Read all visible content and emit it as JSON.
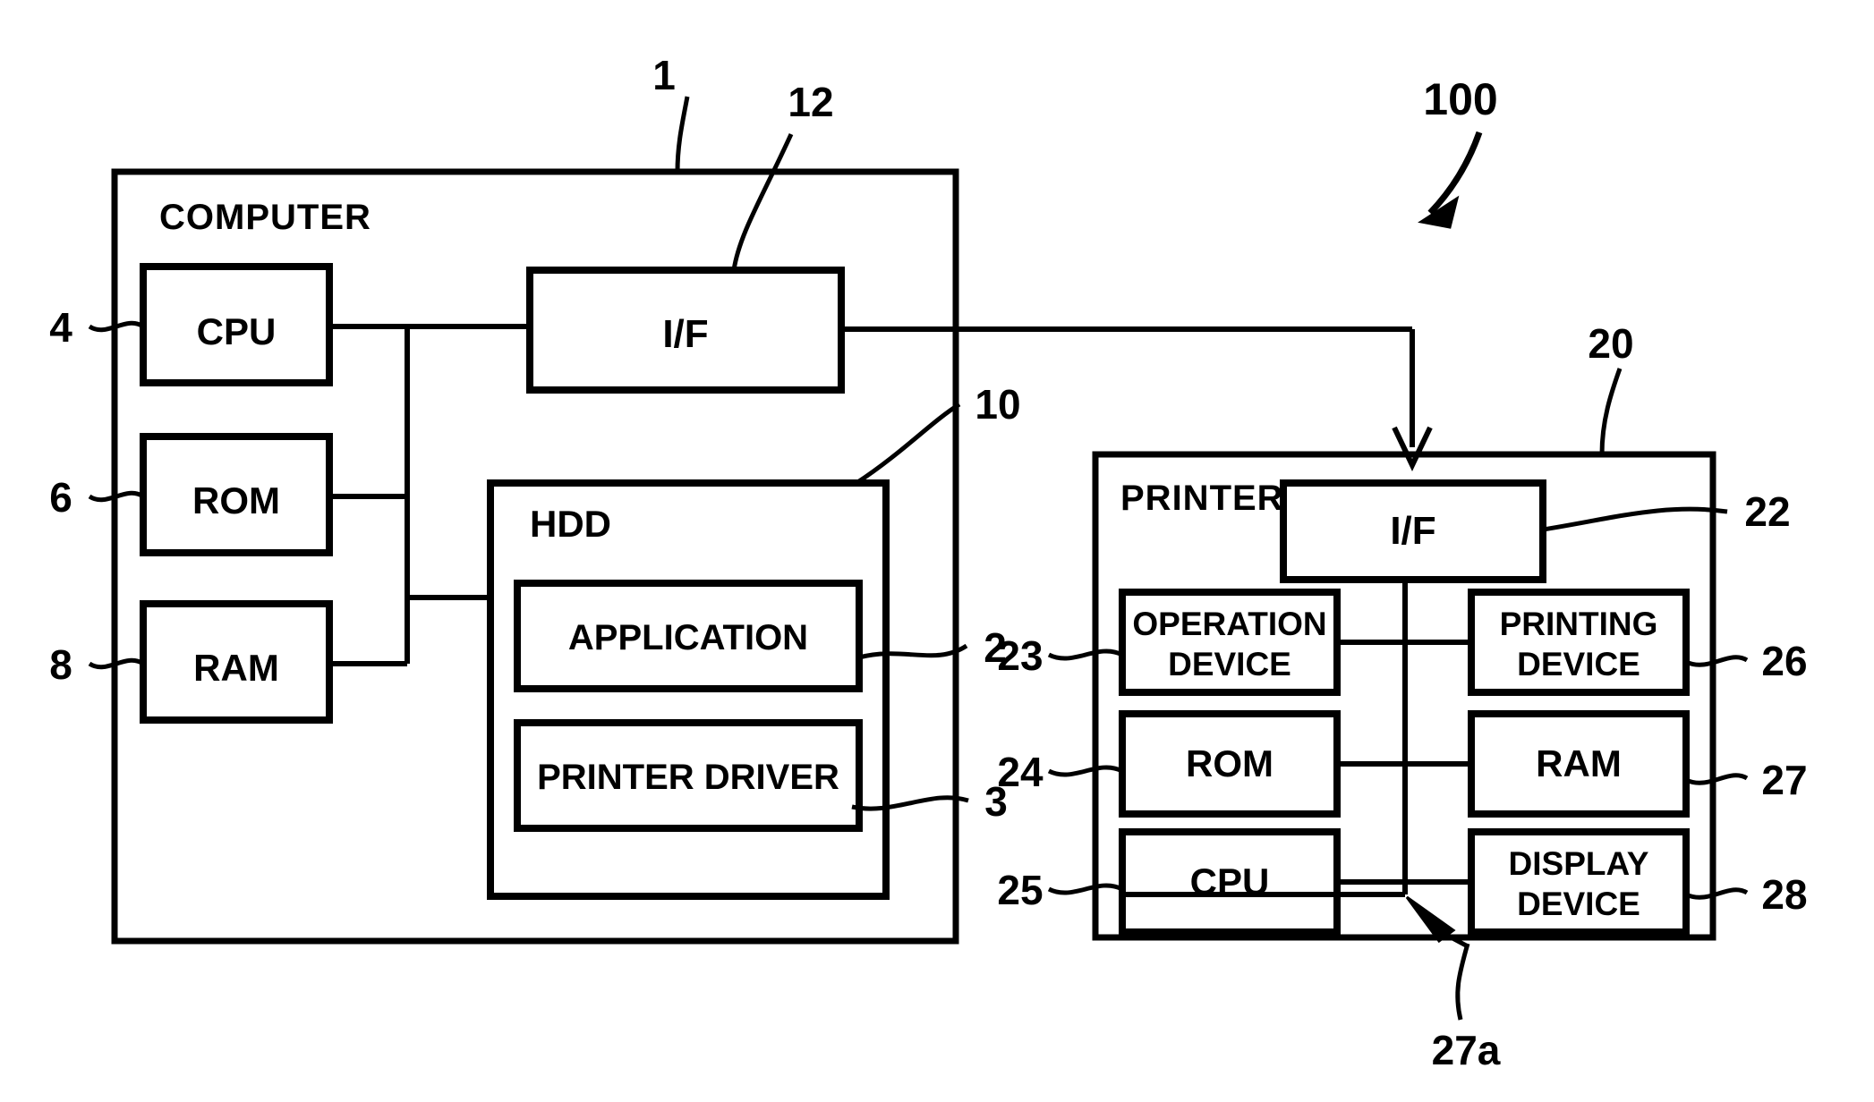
{
  "figure": {
    "type": "patent-block-diagram",
    "system_reference": "100",
    "description": "Block diagram of a computer connected to a printer"
  },
  "computer": {
    "title": "COMPUTER",
    "reference": "1",
    "blocks": [
      {
        "label": "CPU",
        "reference": "4"
      },
      {
        "label": "ROM",
        "reference": "6"
      },
      {
        "label": "RAM",
        "reference": "8"
      },
      {
        "label": "I/F",
        "reference": "12"
      },
      {
        "label": "HDD",
        "reference": "10"
      },
      {
        "label": "APPLICATION",
        "reference": "2"
      },
      {
        "label": "PRINTER DRIVER",
        "reference": "3"
      }
    ]
  },
  "printer": {
    "title": "PRINTER",
    "reference": "20",
    "blocks": [
      {
        "label": "I/F",
        "reference": "22"
      },
      {
        "label": "OPERATION DEVICE",
        "line1": "OPERATION",
        "line2": "DEVICE",
        "reference": "23"
      },
      {
        "label": "PRINTING DEVICE",
        "line1": "PRINTING",
        "line2": "DEVICE",
        "reference": "26"
      },
      {
        "label": "ROM",
        "reference": "24"
      },
      {
        "label": "RAM",
        "reference": "27"
      },
      {
        "label": "CPU",
        "reference": "25"
      },
      {
        "label": "DISPLAY DEVICE",
        "line1": "DISPLAY",
        "line2": "DEVICE",
        "reference": "28"
      }
    ],
    "bus_reference": "27a"
  },
  "colors": {
    "ink": "#000000",
    "paper": "#ffffff"
  }
}
